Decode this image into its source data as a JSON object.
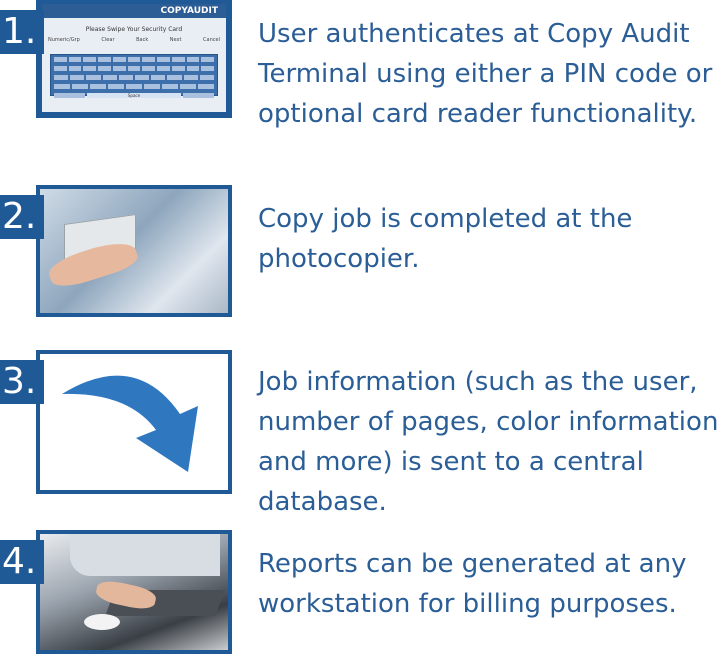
{
  "steps": [
    {
      "number": "1.",
      "text": "User authenticates at Copy Audit Terminal using either a PIN code or optional card reader functionality.",
      "screen": {
        "logo": "COPYAUDIT",
        "prompt": "Please Swipe Your Security Card",
        "options": [
          "Numeric/Grp",
          "Clear",
          "Back",
          "Next",
          "Cancel"
        ],
        "space_label": "Space"
      }
    },
    {
      "number": "2.",
      "text": "Copy job is completed at the photocopier."
    },
    {
      "number": "3.",
      "text": "Job information (such as the user, number of pages, color information and more) is sent to a central database."
    },
    {
      "number": "4.",
      "text": "Reports can be generated at any workstation for billing purposes."
    }
  ],
  "colors": {
    "frame": "#1f5a96",
    "text": "#2b5e96",
    "arrow": "#2f78c0"
  }
}
